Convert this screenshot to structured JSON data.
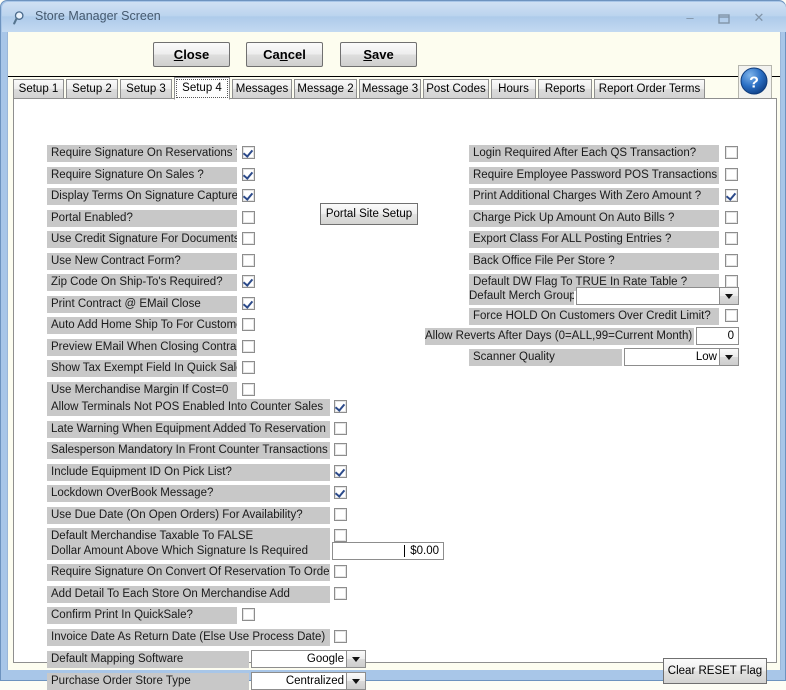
{
  "window": {
    "title": "Store Manager Screen",
    "icon": "magnifier-icon",
    "minimize": "–",
    "maximize": "❐",
    "close": "✕"
  },
  "toolbar": {
    "close_label": "Close",
    "cancel_label": "Cancel",
    "save_label": "Save",
    "help_label": "?"
  },
  "tabs": [
    {
      "label": "Setup 1",
      "active": false
    },
    {
      "label": "Setup 2",
      "active": false
    },
    {
      "label": "Setup 3",
      "active": false
    },
    {
      "label": "Setup 4",
      "active": true
    },
    {
      "label": "Messages",
      "active": false
    },
    {
      "label": "Message 2",
      "active": false
    },
    {
      "label": "Message 3",
      "active": false
    },
    {
      "label": "Post Codes",
      "active": false
    },
    {
      "label": "Hours",
      "active": false
    },
    {
      "label": "Reports",
      "active": false
    },
    {
      "label": "Report Order Terms",
      "active": false
    }
  ],
  "left_column": [
    {
      "label": "Require Signature On Reservations ?",
      "checked": true
    },
    {
      "label": "Require Signature On Sales ?",
      "checked": true
    },
    {
      "label": "Display Terms On Signature Capture?",
      "checked": true
    },
    {
      "label": "Portal Enabled?",
      "checked": false
    },
    {
      "label": "Use Credit Signature For Documents?",
      "checked": false
    },
    {
      "label": "Use New Contract Form?",
      "checked": false
    },
    {
      "label": "Zip Code On Ship-To's Required?",
      "checked": true
    },
    {
      "label": "Print Contract @ EMail Close",
      "checked": true
    },
    {
      "label": "Auto Add Home Ship To For Customer",
      "checked": false
    },
    {
      "label": "Preview EMail When Closing Contract",
      "checked": false
    },
    {
      "label": "Show Tax Exempt Field In Quick Sale",
      "checked": false
    },
    {
      "label": "Use Merchandise Margin If Cost=0",
      "checked": false
    }
  ],
  "portal_button": {
    "label": "Portal Site Setup"
  },
  "right_column": [
    {
      "label": "Login Required After Each QS Transaction?",
      "checked": false
    },
    {
      "label": "Require Employee Password POS Transactions ?",
      "checked": false
    },
    {
      "label": "Print Additional Charges With Zero Amount ?",
      "checked": true
    },
    {
      "label": "Charge Pick Up Amount On Auto Bills ?",
      "checked": false
    },
    {
      "label": "Export Class For ALL Posting Entries ?",
      "checked": false
    },
    {
      "label": "Back Office File Per Store ?",
      "checked": false
    },
    {
      "label": "Default DW Flag To TRUE In Rate Table ?",
      "checked": false
    }
  ],
  "merch_group": {
    "label": "Default Merch Group",
    "value": ""
  },
  "force_hold": {
    "label": "Force HOLD On Customers Over Credit Limit?",
    "checked": false
  },
  "allow_reverts": {
    "label": "Allow Reverts After Days (0=ALL,99=Current Month)",
    "value": "0"
  },
  "scanner_quality": {
    "label": "Scanner Quality",
    "value": "Low"
  },
  "mid_column": [
    {
      "label": "Allow Terminals Not POS Enabled Into Counter Sales",
      "checked": true
    },
    {
      "label": "Late Warning When Equipment Added To Reservation",
      "checked": false
    },
    {
      "label": "Salesperson Mandatory In Front Counter Transactions",
      "checked": false
    },
    {
      "label": "Include Equipment ID On Pick List?",
      "checked": true
    },
    {
      "label": "Lockdown OverBook Message?",
      "checked": true
    },
    {
      "label": "Use Due Date (On Open Orders) For Availability?",
      "checked": false
    },
    {
      "label": "Default Merchandise Taxable To FALSE",
      "checked": false
    }
  ],
  "dollar_amount": {
    "label": "Dollar Amount Above Which Signature Is Required",
    "value": "$0.00"
  },
  "lower_column": [
    {
      "label": "Require Signature On Convert Of Reservation To Order",
      "checked": false
    },
    {
      "label": "Add Detail To Each Store On Merchandise Add",
      "checked": false
    },
    {
      "label": "Confirm Print In QuickSale?",
      "checked": false,
      "narrow": true
    },
    {
      "label": "Invoice Date As Return Date (Else Use Process Date)",
      "checked": false
    }
  ],
  "mapping_software": {
    "label": "Default Mapping Software",
    "value": "Google"
  },
  "po_store_type": {
    "label": "Purchase Order Store Type",
    "value": "Centralized"
  },
  "clear_reset": {
    "label": "Clear RESET Flag"
  },
  "colors": {
    "window_frame": "#a8c6e8",
    "toolbar_bg": "#fdfdef",
    "label_bg": "#c8c8c8",
    "checkmark": "#2c4a8a",
    "help_blue": "#1f5fb0"
  }
}
